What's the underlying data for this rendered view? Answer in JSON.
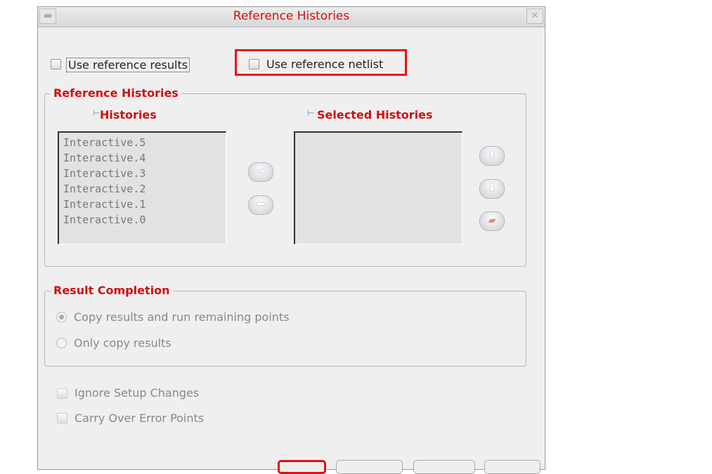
{
  "window": {
    "title": "Reference Histories"
  },
  "options": {
    "use_reference_results": "Use reference results",
    "use_reference_netlist": "Use reference netlist"
  },
  "reference_histories": {
    "legend": "Reference Histories",
    "histories_label": "Histories",
    "selected_label": "Selected Histories",
    "histories": [
      "Interactive.5",
      "Interactive.4",
      "Interactive.3",
      "Interactive.2",
      "Interactive.1",
      "Interactive.0"
    ],
    "selected": []
  },
  "result_completion": {
    "legend": "Result Completion",
    "options": [
      "Copy results and run remaining points",
      "Only copy results"
    ],
    "selected": 0
  },
  "extra": {
    "ignore_setup": "Ignore Setup Changes",
    "carry_over": "Carry Over Error Points"
  },
  "colors": {
    "accent": "#d01010",
    "highlight": "#ee1111"
  }
}
